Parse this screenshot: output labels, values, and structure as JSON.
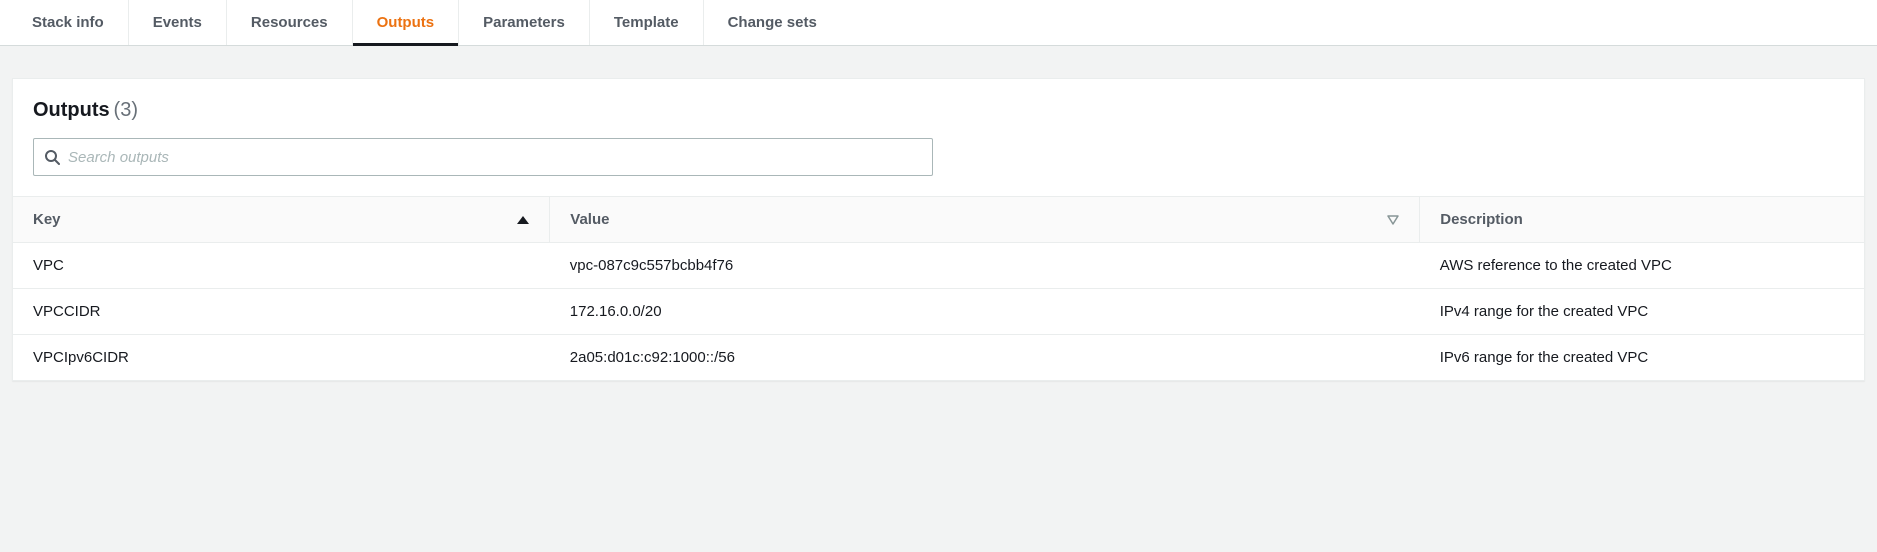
{
  "tabs": [
    {
      "label": "Stack info",
      "active": false
    },
    {
      "label": "Events",
      "active": false
    },
    {
      "label": "Resources",
      "active": false
    },
    {
      "label": "Outputs",
      "active": true
    },
    {
      "label": "Parameters",
      "active": false
    },
    {
      "label": "Template",
      "active": false
    },
    {
      "label": "Change sets",
      "active": false
    }
  ],
  "panel": {
    "title": "Outputs",
    "count": "(3)"
  },
  "search": {
    "placeholder": "Search outputs"
  },
  "table": {
    "columns": {
      "key": "Key",
      "value": "Value",
      "description": "Description"
    },
    "rows": [
      {
        "key": "VPC",
        "value": "vpc-087c9c557bcbb4f76",
        "description": "AWS reference to the created VPC"
      },
      {
        "key": "VPCCIDR",
        "value": "172.16.0.0/20",
        "description": "IPv4 range for the created VPC"
      },
      {
        "key": "VPCIpv6CIDR",
        "value": "2a05:d01c:c92:1000::/56",
        "description": "IPv6 range for the created VPC"
      }
    ]
  }
}
